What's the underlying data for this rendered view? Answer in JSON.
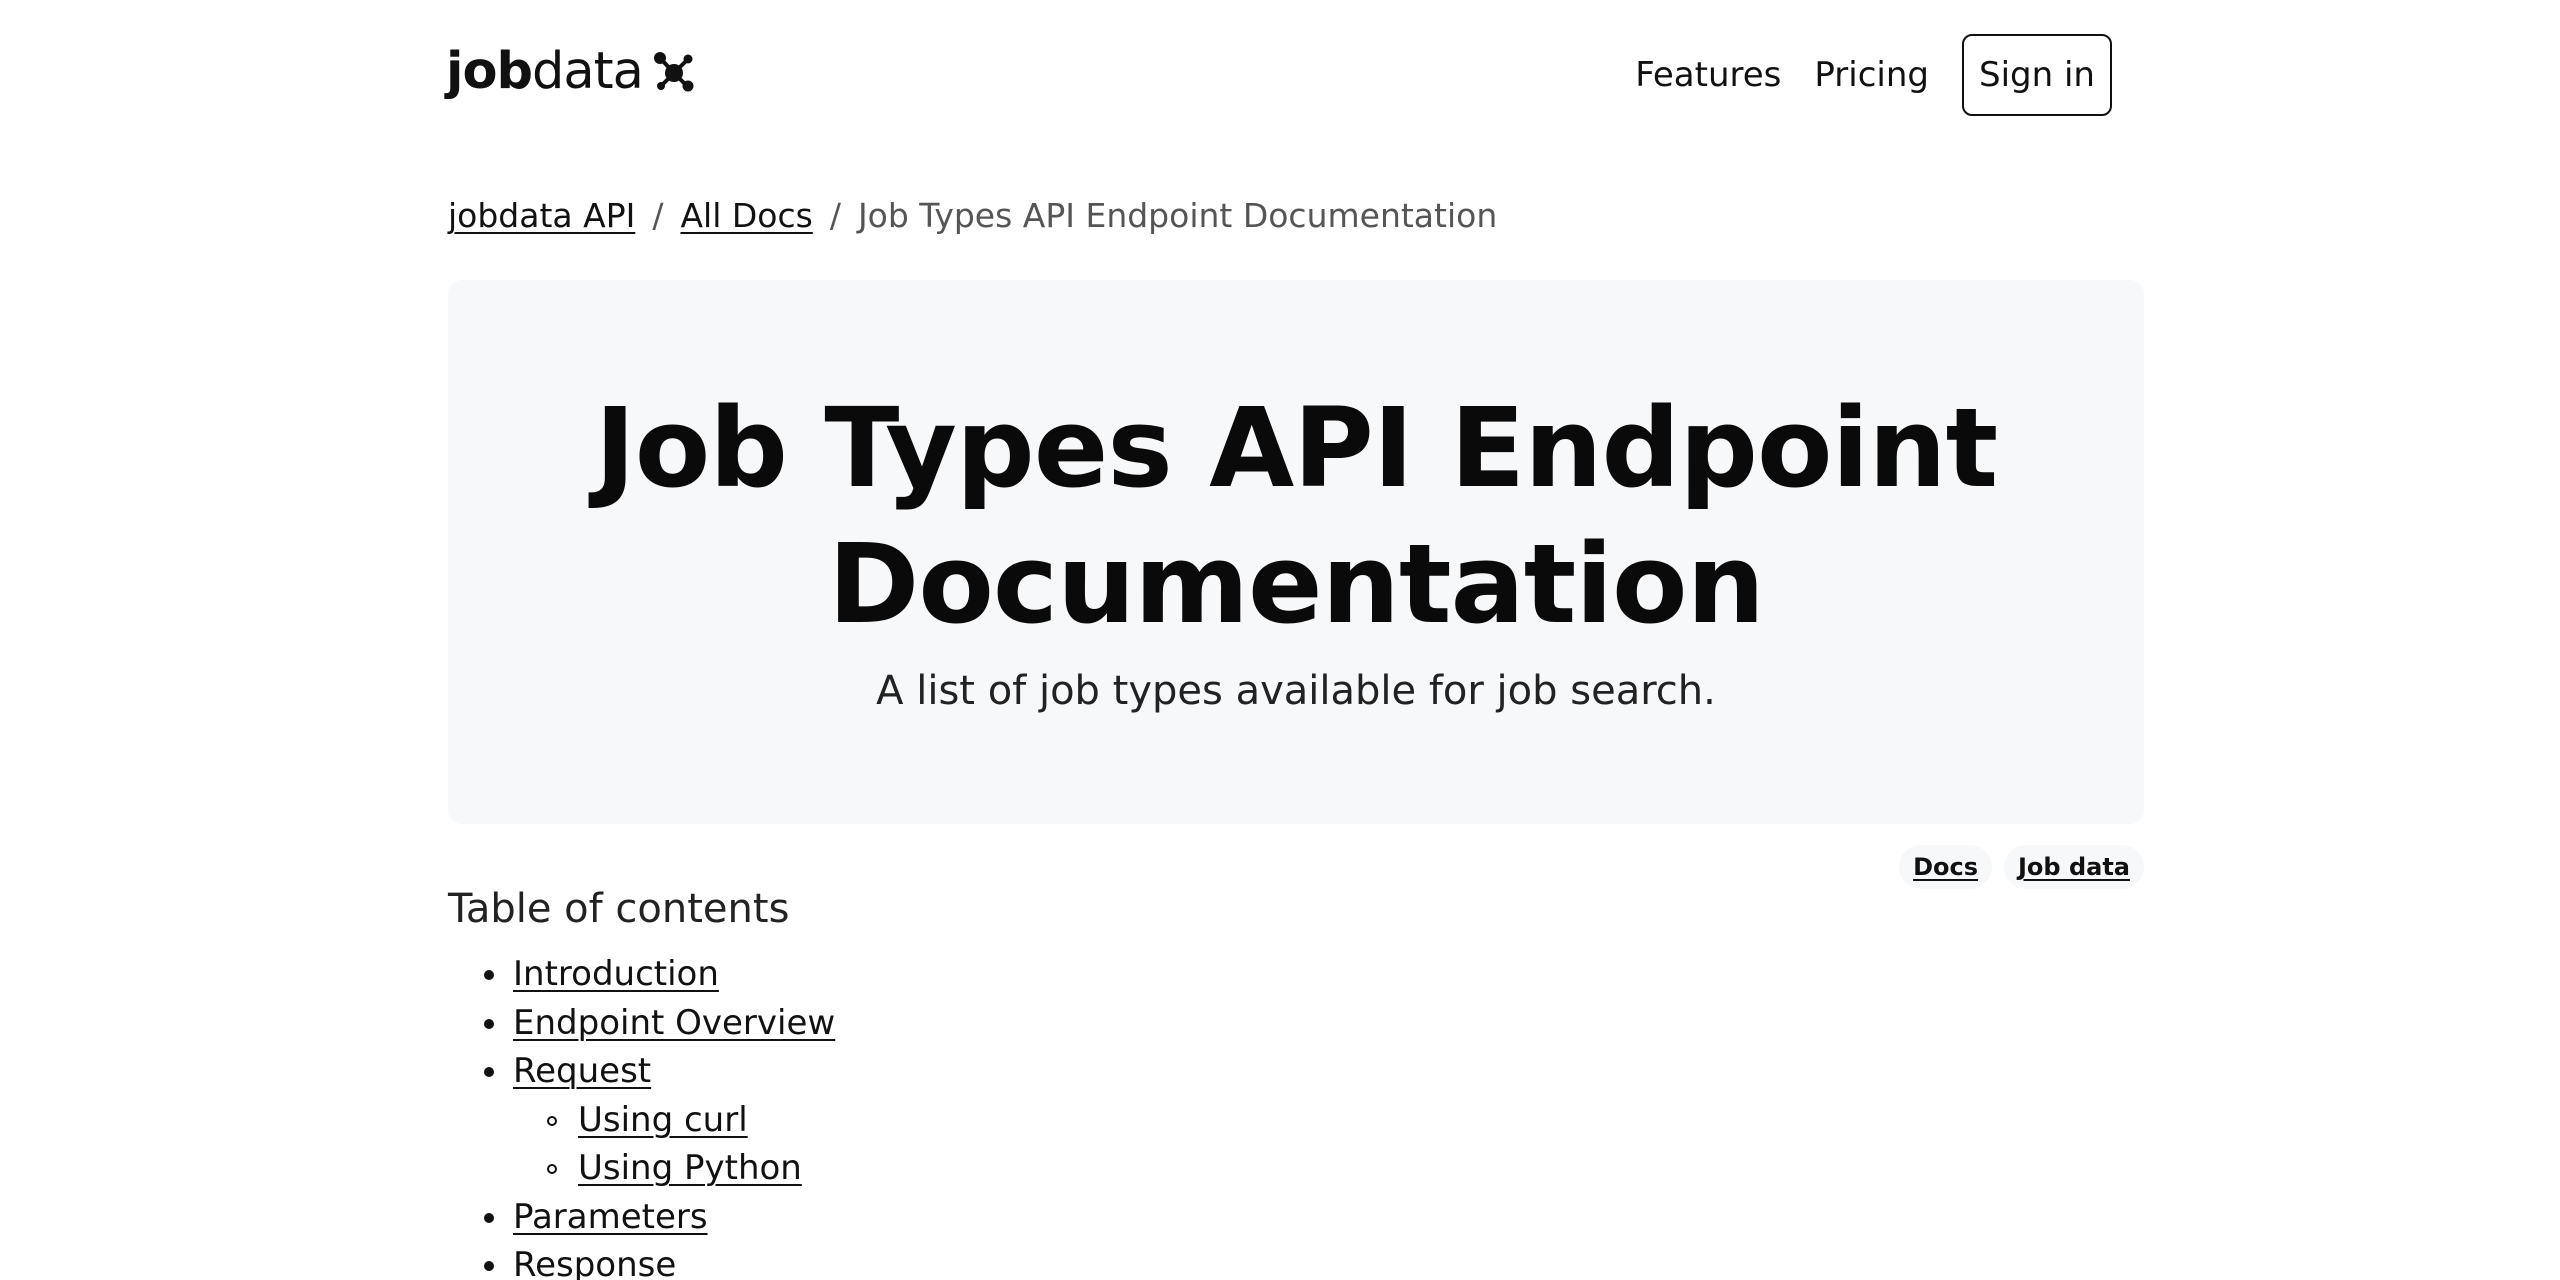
{
  "logo": {
    "bold": "job",
    "light": "data"
  },
  "nav": {
    "features": "Features",
    "pricing": "Pricing",
    "signin": "Sign in"
  },
  "breadcrumb": {
    "items": [
      "jobdata API",
      "All Docs"
    ],
    "current": "Job Types API Endpoint Documentation",
    "separator": "/"
  },
  "hero": {
    "title_line1": "Job Types API Endpoint",
    "title_line2": "Documentation",
    "subtitle": "A list of job types available for job search."
  },
  "tags": [
    "Docs",
    "Job data"
  ],
  "toc": {
    "title": "Table of contents",
    "items": [
      {
        "label": "Introduction",
        "level": 1
      },
      {
        "label": "Endpoint Overview",
        "level": 1
      },
      {
        "label": "Request",
        "level": 1
      },
      {
        "label": "Using curl",
        "level": 2
      },
      {
        "label": "Using Python",
        "level": 2
      },
      {
        "label": "Parameters",
        "level": 1
      },
      {
        "label": "Response",
        "level": 1
      }
    ]
  }
}
